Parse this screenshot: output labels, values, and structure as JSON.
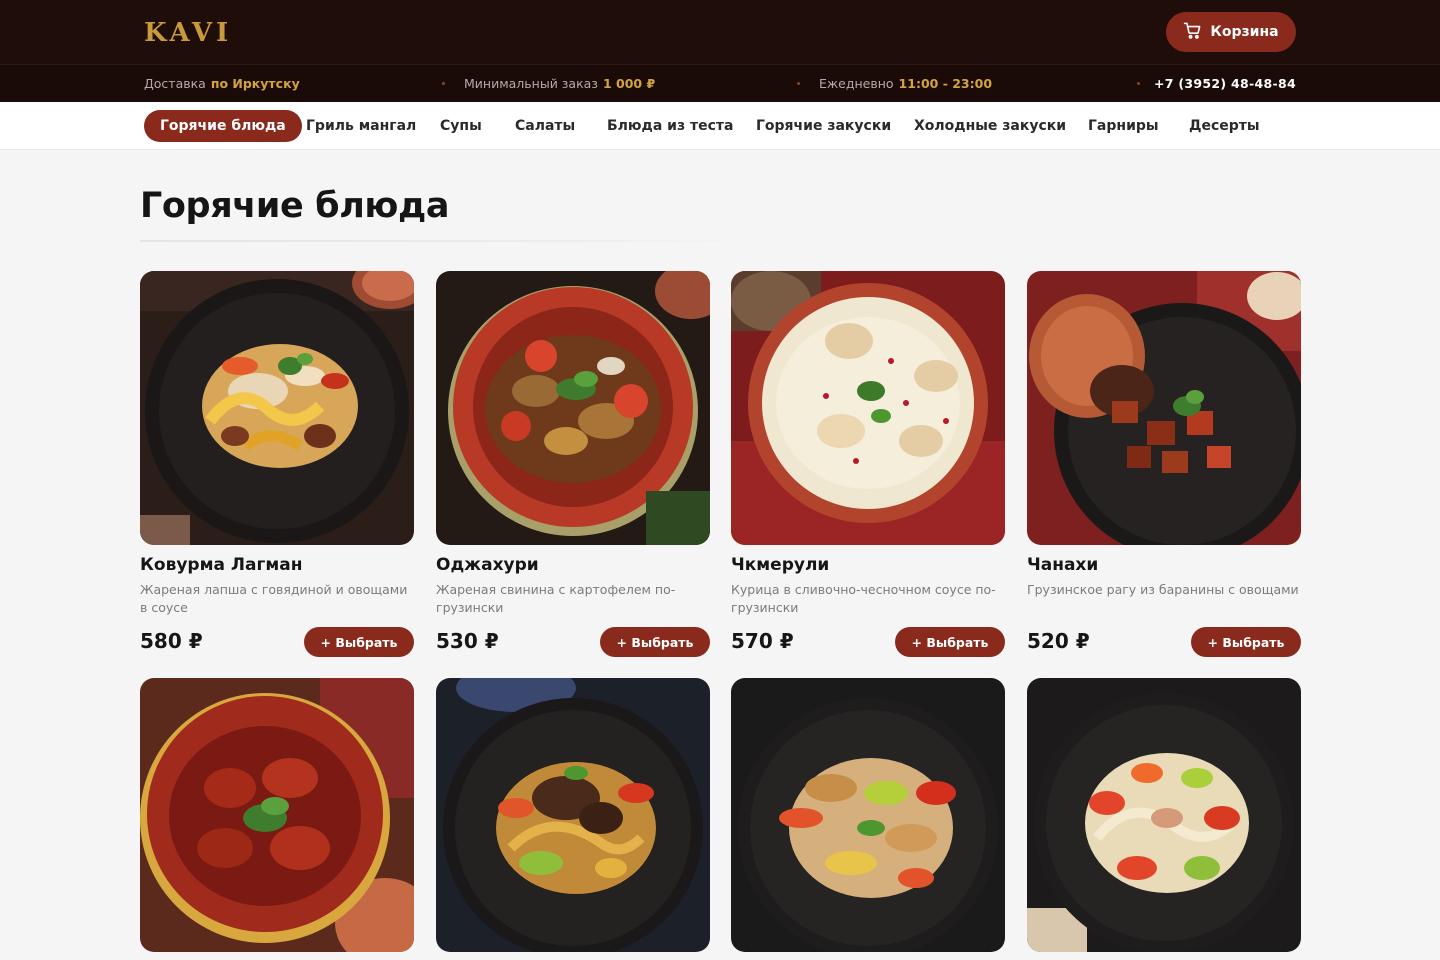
{
  "header": {
    "logo": "KAVI",
    "cart_label": "Корзина",
    "cart_icon": "cart-icon"
  },
  "infobar": {
    "delivery_label": "Доставка",
    "delivery_value": "по Иркутску",
    "min_order_label": "Минимальный заказ",
    "min_order_value": "1 000 ₽",
    "hours_label": "Ежедневно",
    "hours_value": "11:00 - 23:00",
    "phone": "+7 (3952) 48-48-84"
  },
  "categories": [
    {
      "label": "Горячие блюда",
      "active": true
    },
    {
      "label": "Гриль мангал"
    },
    {
      "label": "Супы"
    },
    {
      "label": "Салаты"
    },
    {
      "label": "Блюда из теста"
    },
    {
      "label": "Горячие закуски"
    },
    {
      "label": "Холодные закуски"
    },
    {
      "label": "Гарниры"
    },
    {
      "label": "Десерты"
    }
  ],
  "section": {
    "title": "Горячие блюда"
  },
  "products": [
    {
      "name": "Ковурма Лагман",
      "description": "Жареная лапша с говядиной и овощами в соусе",
      "price": "580 ₽",
      "button": "+ Выбрать"
    },
    {
      "name": "Оджахури",
      "description": "Жареная свинина с картофелем по-грузински",
      "price": "530 ₽",
      "button": "+ Выбрать"
    },
    {
      "name": "Чкмерули",
      "description": "Курица в сливочно-чесночном соусе по-грузински",
      "price": "570 ₽",
      "button": "+ Выбрать"
    },
    {
      "name": "Чанахи",
      "description": "Грузинское рагу из баранины с овощами",
      "price": "520 ₽",
      "button": "+ Выбрать"
    }
  ],
  "colors": {
    "accent": "#8a2a1d",
    "topbar": "#1f0d0a",
    "gold": "#d4a43b"
  }
}
